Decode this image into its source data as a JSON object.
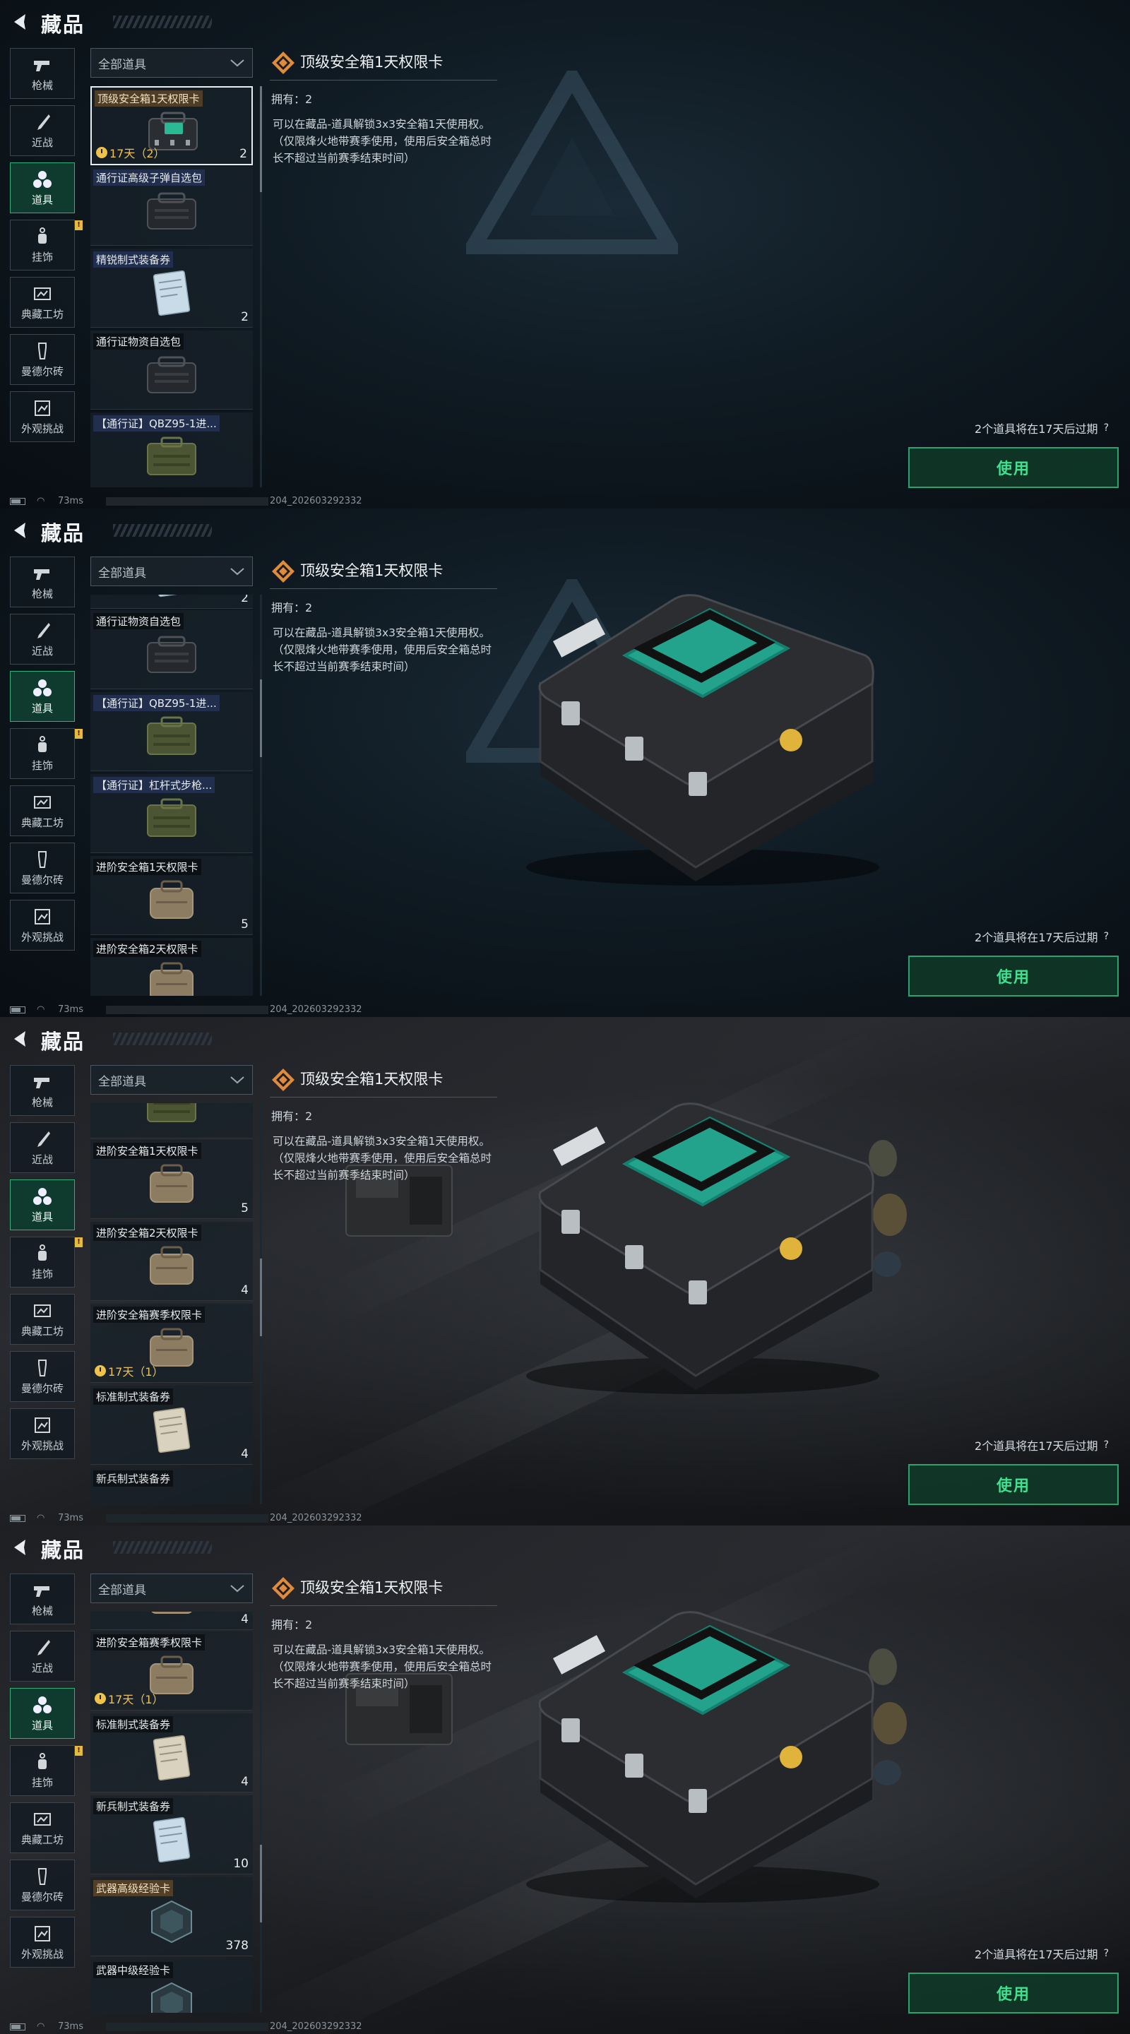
{
  "header": {
    "title": "藏品"
  },
  "nav": [
    {
      "label": "枪械",
      "icon": "gun-icon"
    },
    {
      "label": "近战",
      "icon": "knife-icon"
    },
    {
      "label": "道具",
      "icon": "items-icon",
      "active": true
    },
    {
      "label": "挂饰",
      "icon": "charm-icon",
      "badge": "!"
    },
    {
      "label": "典藏工坊",
      "icon": "workshop-icon"
    },
    {
      "label": "曼德尔砖",
      "icon": "brick-icon"
    },
    {
      "label": "外观挑战",
      "icon": "challenge-icon"
    }
  ],
  "filter": {
    "label": "全部道具"
  },
  "detail": {
    "title": "顶级安全箱1天权限卡",
    "owned": "拥有：2",
    "description": "可以在藏品-道具解锁3x3安全箱1天使用权。（仅限烽火地带赛季使用，使用后安全箱总时长不超过当前赛季结束时间）",
    "expire_note": "2个道具将在17天后过期",
    "help": "?",
    "use_label": "使用"
  },
  "items": {
    "top_card": {
      "name": "顶级安全箱1天权限卡",
      "count": "2",
      "timer": "17天（2）"
    },
    "ammo_pack": {
      "name": "通行证高级子弹自选包"
    },
    "elite_voucher": {
      "name": "精锐制式装备券",
      "count": "2"
    },
    "supply_pack": {
      "name": "通行证物资自选包"
    },
    "qbz": {
      "name": "【通行证】QBZ95-1进..."
    },
    "lever": {
      "name": "【通行证】杠杆式步枪..."
    },
    "adv_1day": {
      "name": "进阶安全箱1天权限卡",
      "count": "5"
    },
    "adv_2day": {
      "name": "进阶安全箱2天权限卡",
      "count": "4"
    },
    "adv_season": {
      "name": "进阶安全箱赛季权限卡",
      "timer": "17天（1）"
    },
    "std_voucher": {
      "name": "标准制式装备券",
      "count": "4"
    },
    "rookie_voucher": {
      "name": "新兵制式装备券",
      "count": "10"
    },
    "weapon_hi": {
      "name": "武器高级经验卡",
      "count": "378"
    },
    "weapon_mid": {
      "name": "武器中级经验卡"
    },
    "partial_count_2": "2",
    "partial_count_4": "4",
    "partial_next": "新兵制式装备券"
  },
  "status": {
    "ping": "73ms",
    "build": "204_202603292332"
  },
  "colors": {
    "accent": "#2ba36c",
    "accent_text": "#3fe08f",
    "timer": "#f0c24a",
    "badge": "#e8b93a"
  }
}
